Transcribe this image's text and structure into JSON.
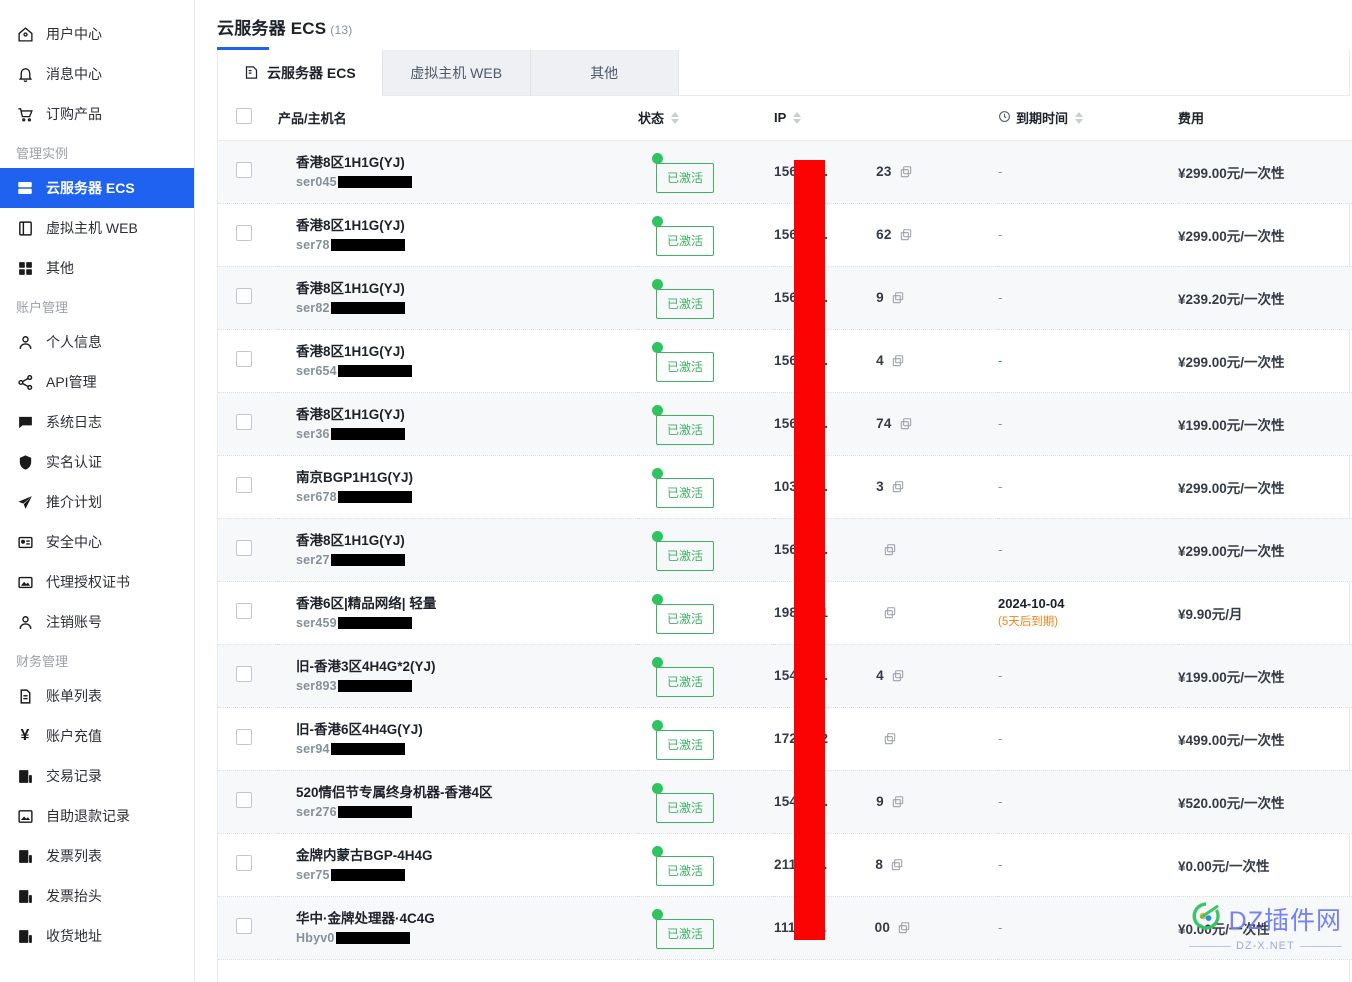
{
  "sidebar": {
    "top_items": [
      {
        "label": "用户中心",
        "icon": "home-icon"
      },
      {
        "label": "消息中心",
        "icon": "bell-icon"
      },
      {
        "label": "订购产品",
        "icon": "cart-icon"
      }
    ],
    "group_manage_label": "管理实例",
    "manage_items": [
      {
        "label": "云服务器 ECS",
        "icon": "server-icon",
        "active": true
      },
      {
        "label": "虚拟主机 WEB",
        "icon": "book-icon",
        "active": false
      },
      {
        "label": "其他",
        "icon": "grid-icon",
        "active": false
      }
    ],
    "group_account_label": "账户管理",
    "account_items": [
      {
        "label": "个人信息",
        "icon": "user-icon"
      },
      {
        "label": "API管理",
        "icon": "share-icon"
      },
      {
        "label": "系统日志",
        "icon": "chat-icon"
      },
      {
        "label": "实名认证",
        "icon": "shield-icon"
      },
      {
        "label": "推介计划",
        "icon": "send-icon"
      },
      {
        "label": "安全中心",
        "icon": "id-card-icon"
      },
      {
        "label": "代理授权证书",
        "icon": "certificate-icon"
      },
      {
        "label": "注销账号",
        "icon": "user-icon"
      }
    ],
    "group_finance_label": "财务管理",
    "finance_items": [
      {
        "label": "账单列表",
        "icon": "document-icon"
      },
      {
        "label": "账户充值",
        "icon": "yen-icon"
      },
      {
        "label": "交易记录",
        "icon": "report-icon"
      },
      {
        "label": "自助退款记录",
        "icon": "refund-icon"
      },
      {
        "label": "发票列表",
        "icon": "report-icon"
      },
      {
        "label": "发票抬头",
        "icon": "report-icon"
      },
      {
        "label": "收货地址",
        "icon": "report-icon"
      }
    ]
  },
  "header": {
    "title": "云服务器 ECS",
    "count": "(13)"
  },
  "tabs": [
    {
      "label": "云服务器 ECS",
      "icon": "server-list-icon",
      "active": true
    },
    {
      "label": "虚拟主机 WEB",
      "icon": "",
      "active": false
    },
    {
      "label": "其他",
      "icon": "",
      "active": false
    }
  ],
  "table": {
    "columns": {
      "name": "产品/主机名",
      "status": "状态",
      "ip": "IP",
      "expire": "到期时间",
      "fee": "费用"
    },
    "expire_icon": "clock-icon",
    "rows": [
      {
        "product": "香港8区1H1G(YJ)",
        "host_prefix": "ser045",
        "host_mask_w": 74,
        "status": "已激活",
        "ip_prefix": "156.224.",
        "ip_suffix": "23",
        "expire": "-",
        "expire_link": false,
        "expire_note": "",
        "fee": "¥299.00元/一次性"
      },
      {
        "product": "香港8区1H1G(YJ)",
        "host_prefix": "ser78",
        "host_mask_w": 74,
        "status": "已激活",
        "ip_prefix": "156.224.",
        "ip_suffix": "62",
        "expire": "-",
        "expire_link": false,
        "expire_note": "",
        "fee": "¥299.00元/一次性"
      },
      {
        "product": "香港8区1H1G(YJ)",
        "host_prefix": "ser82",
        "host_mask_w": 74,
        "status": "已激活",
        "ip_prefix": "156.224.",
        "ip_suffix": "9",
        "expire": "-",
        "expire_link": false,
        "expire_note": "",
        "fee": "¥239.20元/一次性"
      },
      {
        "product": "香港8区1H1G(YJ)",
        "host_prefix": "ser654",
        "host_mask_w": 74,
        "status": "已激活",
        "ip_prefix": "156.224.",
        "ip_suffix": "4",
        "expire": "-",
        "expire_link": true,
        "expire_note": "",
        "fee": "¥299.00元/一次性"
      },
      {
        "product": "香港8区1H1G(YJ)",
        "host_prefix": "ser36",
        "host_mask_w": 74,
        "status": "已激活",
        "ip_prefix": "156.224.",
        "ip_suffix": "74",
        "expire": "-",
        "expire_link": false,
        "expire_note": "",
        "fee": "¥199.00元/一次性"
      },
      {
        "product": "南京BGP1H1G(YJ)",
        "host_prefix": "ser678",
        "host_mask_w": 74,
        "status": "已激活",
        "ip_prefix": "103.150.",
        "ip_suffix": "3",
        "expire": "-",
        "expire_link": false,
        "expire_note": "",
        "fee": "¥299.00元/一次性"
      },
      {
        "product": "香港8区1H1G(YJ)",
        "host_prefix": "ser27",
        "host_mask_w": 74,
        "status": "已激活",
        "ip_prefix": "156.224.",
        "ip_suffix": "",
        "expire": "-",
        "expire_link": false,
        "expire_note": "",
        "fee": "¥299.00元/一次性"
      },
      {
        "product": "香港6区|精品网络| 轻量",
        "host_prefix": "ser459",
        "host_mask_w": 74,
        "status": "已激活",
        "ip_prefix": "198.44.1",
        "ip_suffix": "",
        "expire": "2024-10-04",
        "expire_link": false,
        "expire_note": "(5天后到期)",
        "fee": "¥9.90元/月"
      },
      {
        "product": "旧-香港3区4H4G*2(YJ)",
        "host_prefix": "ser893",
        "host_mask_w": 74,
        "status": "已激活",
        "ip_prefix": "154.201.",
        "ip_suffix": "4",
        "expire": "-",
        "expire_link": false,
        "expire_note": "",
        "fee": "¥199.00元/一次性"
      },
      {
        "product": "旧-香港6区4H4G(YJ)",
        "host_prefix": "ser94",
        "host_mask_w": 74,
        "status": "已激活",
        "ip_prefix": "172.98.2",
        "ip_suffix": "",
        "expire": "-",
        "expire_link": false,
        "expire_note": "",
        "fee": "¥499.00元/一次性"
      },
      {
        "product": "520情侣节专属终身机器-香港4区",
        "host_prefix": "ser276",
        "host_mask_w": 74,
        "status": "已激活",
        "ip_prefix": "154.201.",
        "ip_suffix": "9",
        "expire": "-",
        "expire_link": false,
        "expire_note": "",
        "fee": "¥520.00元/一次性"
      },
      {
        "product": "金牌内蒙古BGP-4H4G",
        "host_prefix": "ser75",
        "host_mask_w": 74,
        "status": "已激活",
        "ip_prefix": "211.101.",
        "ip_suffix": "8",
        "expire": "-",
        "expire_link": false,
        "expire_note": "",
        "fee": "¥0.00元/一次性"
      },
      {
        "product": "华中·金牌处理器·4C4G",
        "host_prefix": "Hbyv0",
        "host_mask_w": 74,
        "status": "已激活",
        "ip_prefix": "111.180.",
        "ip_suffix": "00",
        "expire": "-",
        "expire_link": false,
        "expire_note": "",
        "fee": "¥0.00元/一次性"
      }
    ]
  },
  "watermark": {
    "text": "DZ插件网",
    "sub": "DZ-X.NET"
  },
  "colors": {
    "accent": "#1f62f0",
    "status_green": "#3fb264",
    "warn_orange": "#f08219",
    "redaction_red": "#fb0303"
  }
}
